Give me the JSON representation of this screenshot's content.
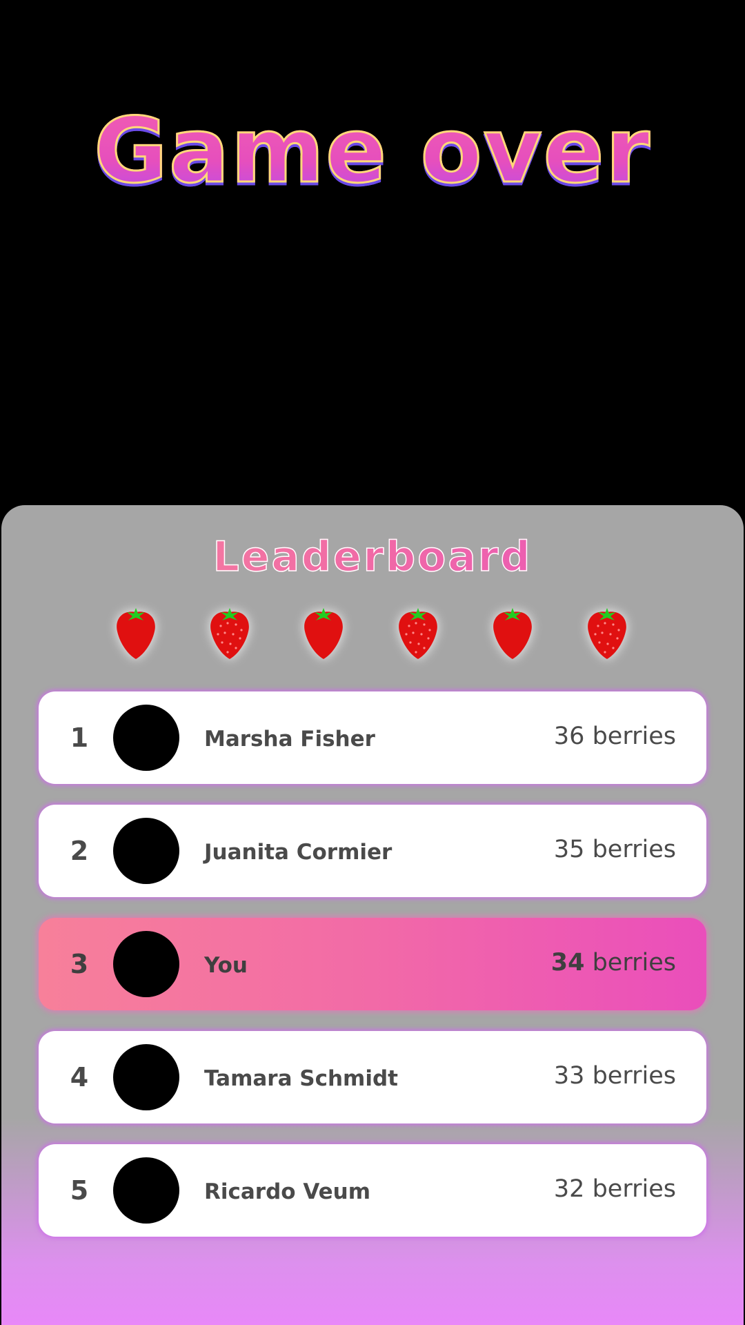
{
  "title": "Game over",
  "leaderboard": {
    "heading": "Leaderboard",
    "berry_icons": [
      "strawberry-icon",
      "strawberry-icon",
      "strawberry-icon",
      "strawberry-icon",
      "strawberry-icon",
      "strawberry-icon"
    ],
    "entries": [
      {
        "rank": "1",
        "name": "Marsha Fisher",
        "score": "36",
        "unit": "berries",
        "is_you": false
      },
      {
        "rank": "2",
        "name": "Juanita Cormier",
        "score": "35",
        "unit": "berries",
        "is_you": false
      },
      {
        "rank": "3",
        "name": "You",
        "score": "34",
        "unit": "berries",
        "is_you": true
      },
      {
        "rank": "4",
        "name": "Tamara Schmidt",
        "score": "33",
        "unit": "berries",
        "is_you": false
      },
      {
        "rank": "5",
        "name": "Ricardo Veum",
        "score": "32",
        "unit": "berries",
        "is_you": false
      }
    ]
  },
  "colors": {
    "background": "#000000",
    "panel": "#a6a6a6",
    "title_pink": "#e64fbd",
    "title_outline": "#ffd978",
    "highlight_start": "#f7809a",
    "highlight_end": "#ea4ebb",
    "berry_red": "#e01010",
    "leaf_green": "#22cc22"
  }
}
